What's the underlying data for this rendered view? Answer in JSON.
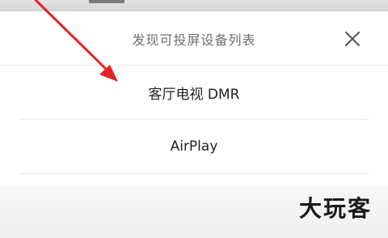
{
  "sheet": {
    "title": "发现可投屏设备列表",
    "close_icon": "close-icon"
  },
  "devices": [
    {
      "label": "客厅电视 DMR"
    },
    {
      "label": "AirPlay"
    }
  ],
  "watermark": "大玩客",
  "annotation": {
    "arrow_color": "#e0242a"
  },
  "colors": {
    "sheet_background": "#ffffff",
    "title_text": "#6f6f6f",
    "item_text": "#222222",
    "divider": "#ececec"
  }
}
